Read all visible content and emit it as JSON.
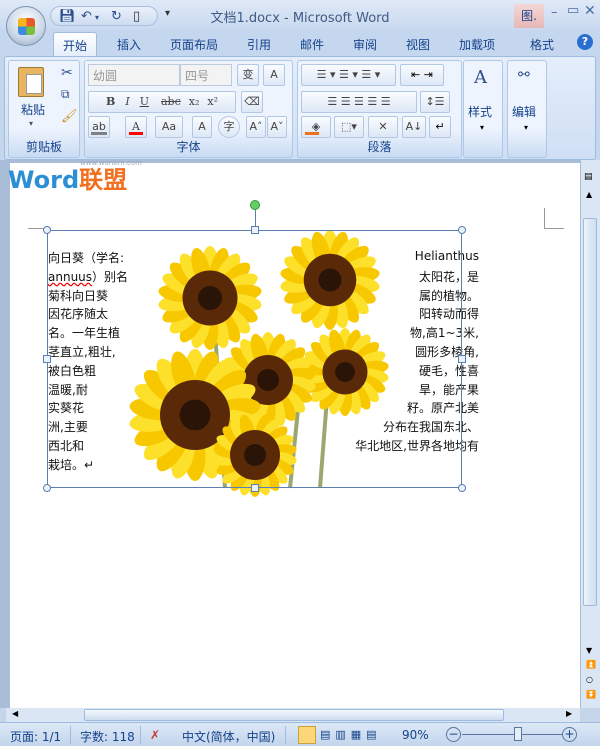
{
  "window": {
    "title": "文档1.docx - Microsoft Word",
    "context_tab": "图.",
    "controls": [
      "minimize",
      "maximize",
      "close"
    ]
  },
  "quick_access": [
    "save-icon",
    "undo-icon",
    "redo-icon",
    "new-document-icon",
    "customize-icon"
  ],
  "tabs": [
    {
      "label": "开始",
      "active": true
    },
    {
      "label": "插入"
    },
    {
      "label": "页面布局"
    },
    {
      "label": "引用"
    },
    {
      "label": "邮件"
    },
    {
      "label": "审阅"
    },
    {
      "label": "视图"
    },
    {
      "label": "加载项"
    },
    {
      "label": "格式"
    }
  ],
  "ribbon": {
    "clipboard": {
      "label": "剪贴板",
      "paste": "粘贴"
    },
    "font": {
      "label": "字体",
      "font_name": "幼圆",
      "font_size": "四号",
      "buttons": [
        "B",
        "I",
        "U",
        "abc",
        "x₂",
        "x²",
        "A",
        "Aa",
        "A",
        "字",
        "A˄",
        "A˅"
      ],
      "font_color": "#ff0000",
      "highlight_color": "#808080"
    },
    "paragraph": {
      "label": "段落",
      "shading_color": "#f07020"
    },
    "styles": {
      "label": "样式"
    },
    "editing": {
      "label": "编辑"
    }
  },
  "watermark": {
    "text": "Word",
    "text2": "联盟",
    "url": "www.wordlm.com"
  },
  "document": {
    "left_lines": [
      "向日葵（学名:",
      "annuus）别名",
      "菊科向日葵",
      "因花序随太",
      "名。一年生植",
      "茎直立,粗壮,",
      "被白色粗",
      "温暖,耐",
      "实葵花",
      "洲,主要",
      "西北和",
      "栽培。↵"
    ],
    "right_lines": [
      "Helianthus",
      "太阳花，是",
      "属的植物。",
      "阳转动而得",
      "物,高1~3米,",
      "圆形多棱角,",
      "硬毛，性喜",
      "旱，能产果",
      "籽。原产北美",
      "分布在我国东北、",
      "华北地区,世界各地均有"
    ]
  },
  "status": {
    "page": "页面: 1/1",
    "words": "字数: 118",
    "language": "中文(简体，中国)",
    "zoom": "90%",
    "zoom_percent": 90
  }
}
